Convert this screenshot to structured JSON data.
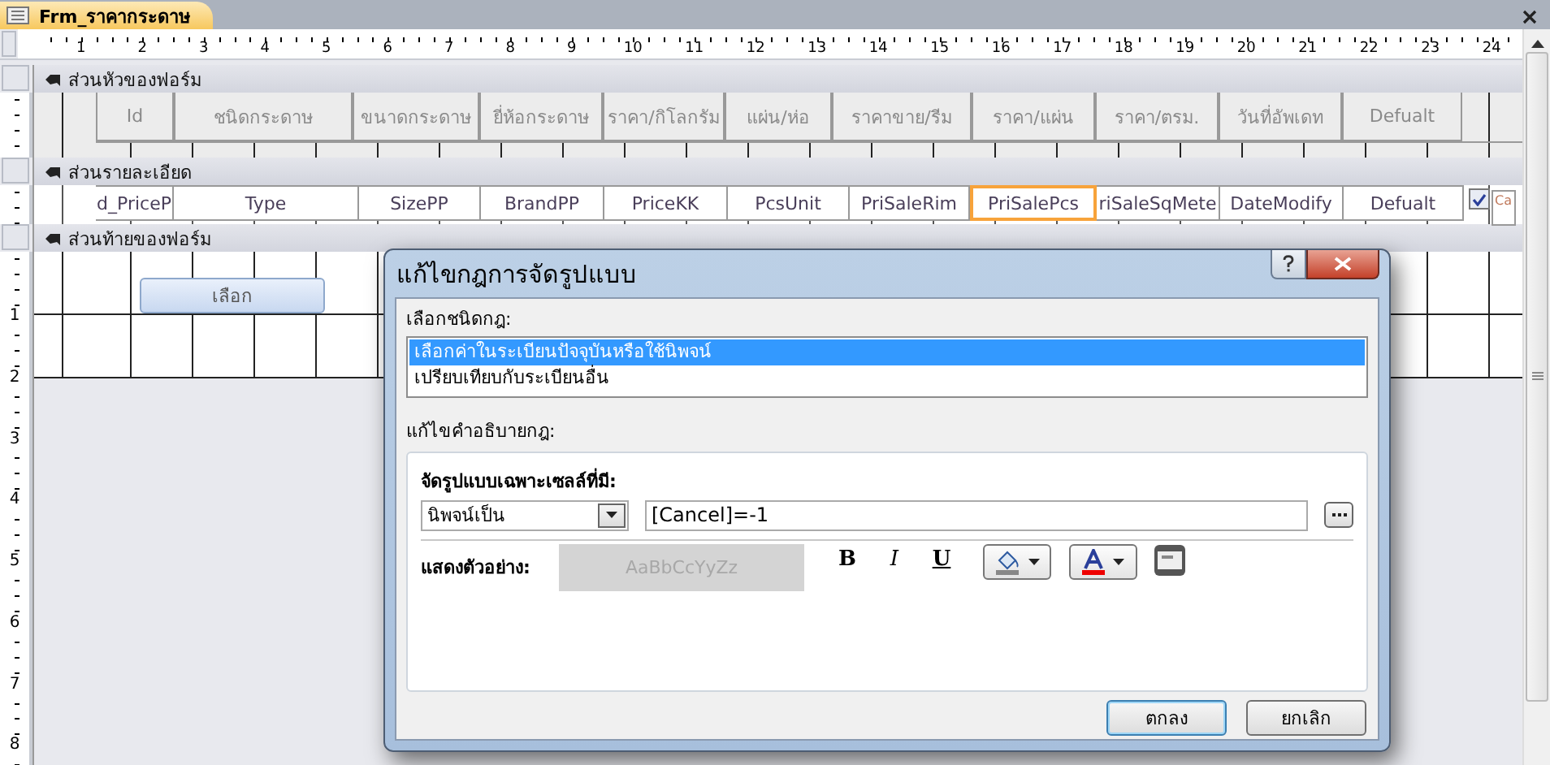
{
  "tab": {
    "label": "Frm_ราคากระดาษ",
    "selected": true
  },
  "ruler": {
    "numbers": [
      "1",
      "2",
      "3",
      "4",
      "5",
      "6",
      "7",
      "8",
      "9",
      "10",
      "11",
      "12",
      "13",
      "14",
      "15",
      "16",
      "17",
      "18",
      "19",
      "20",
      "21",
      "22",
      "23",
      "24"
    ]
  },
  "sections": [
    {
      "kind": "header",
      "title": "ส่วนหัวของฟอร์ม",
      "labels": [
        "Id",
        "ชนิดกระดาษ",
        "ขนาดกระดาษ",
        "ยี่ห้อกระดาษ",
        "ราคา/กิโลกรัม",
        "แผ่น/ห่อ",
        "ราคาขาย/รีม",
        "ราคา/แผ่น",
        "ราคา/ตรม.",
        "วันที่อัพเดท",
        "Defualt"
      ]
    },
    {
      "kind": "detail",
      "title": "ส่วนรายละเอียด",
      "fields": [
        {
          "text": "d_PriceP",
          "selected": false
        },
        {
          "text": "Type",
          "selected": false
        },
        {
          "text": "SizePP",
          "selected": false
        },
        {
          "text": "BrandPP",
          "selected": false
        },
        {
          "text": "PriceKK",
          "selected": false
        },
        {
          "text": "PcsUnit",
          "selected": false
        },
        {
          "text": "PriSaleRim",
          "selected": false
        },
        {
          "text": "PriSalePcs",
          "selected": true
        },
        {
          "text": "riSaleSqMete",
          "selected": false
        },
        {
          "text": "DateModify",
          "selected": false
        },
        {
          "text": "Defualt",
          "selected": false
        }
      ],
      "checkbox": {
        "checked": true,
        "label": "Ca"
      }
    },
    {
      "kind": "footer",
      "title": "ส่วนท้ายของฟอร์ม",
      "button": "เลือก",
      "ruler_numbers": [
        "1",
        "2",
        "3",
        "4",
        "5",
        "6",
        "7",
        "8"
      ]
    }
  ],
  "dialog": {
    "title": "แก้ไขกฎการจัดรูปแบบ",
    "rule_type_label": "เลือกชนิดกฎ:",
    "rule_types": [
      {
        "label": "เลือกค่าในระเบียนปัจจุบันหรือใช้นิพจน์",
        "selected": true
      },
      {
        "label": "เปรียบเทียบกับระเบียนอื่น",
        "selected": false
      }
    ],
    "description_label": "แก้ไขคำอธิบายกฎ:",
    "format_label": "จัดรูปแบบเฉพาะเซลล์ที่มี:",
    "condition": "นิพจน์เป็น",
    "expression": "[Cancel]=-1",
    "preview_label": "แสดงตัวอย่าง:",
    "preview_text": "AaBbCcYyZz",
    "styles": [
      {
        "kind": "bold",
        "label": "B"
      },
      {
        "kind": "italic",
        "label": "I"
      },
      {
        "kind": "underline",
        "label": "U"
      }
    ],
    "ok": "ตกลง",
    "cancel": "ยกเลิก"
  }
}
